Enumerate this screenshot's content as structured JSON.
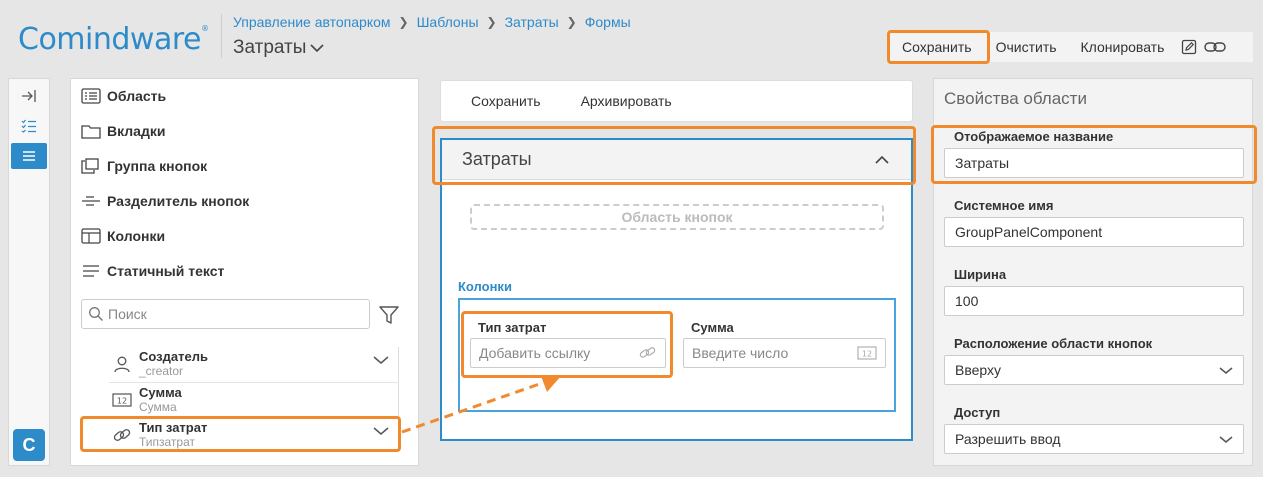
{
  "app": {
    "logo": "Comindware"
  },
  "breadcrumb": [
    "Управление автопарком",
    "Шаблоны",
    "Затраты",
    "Формы"
  ],
  "page_title": "Затраты",
  "toolbar": {
    "save_label": "Сохранить",
    "clear_label": "Очистить",
    "clone_label": "Клонировать"
  },
  "components": {
    "items": [
      "Область",
      "Вкладки",
      "Группа кнопок",
      "Разделитель кнопок",
      "Колонки",
      "Статичный текст"
    ],
    "search_placeholder": "Поиск"
  },
  "attributes": [
    {
      "name": "Создатель",
      "system": "_creator"
    },
    {
      "name": "Сумма",
      "system": "Сумма"
    },
    {
      "name": "Тип затрат",
      "system": "Типзатрат"
    }
  ],
  "form": {
    "save_label": "Сохранить",
    "archive_label": "Архивировать",
    "group_title": "Затраты",
    "button_area_label": "Область кнопок",
    "columns_label": "Колонки",
    "fields": [
      {
        "label": "Тип затрат",
        "placeholder": "Добавить ссылку"
      },
      {
        "label": "Сумма",
        "placeholder": "Введите число"
      }
    ]
  },
  "properties": {
    "title": "Свойства области",
    "display_name_label": "Отображаемое название",
    "display_name_value": "Затраты",
    "system_name_label": "Системное имя",
    "system_name_value": "GroupPanelComponent",
    "width_label": "Ширина",
    "width_value": "100",
    "button_area_position_label": "Расположение области кнопок",
    "button_area_position_value": "Вверху",
    "access_label": "Доступ",
    "access_value": "Разрешить ввод"
  },
  "colors": {
    "accent": "#2e8bc9",
    "highlight": "#f08a2c"
  }
}
